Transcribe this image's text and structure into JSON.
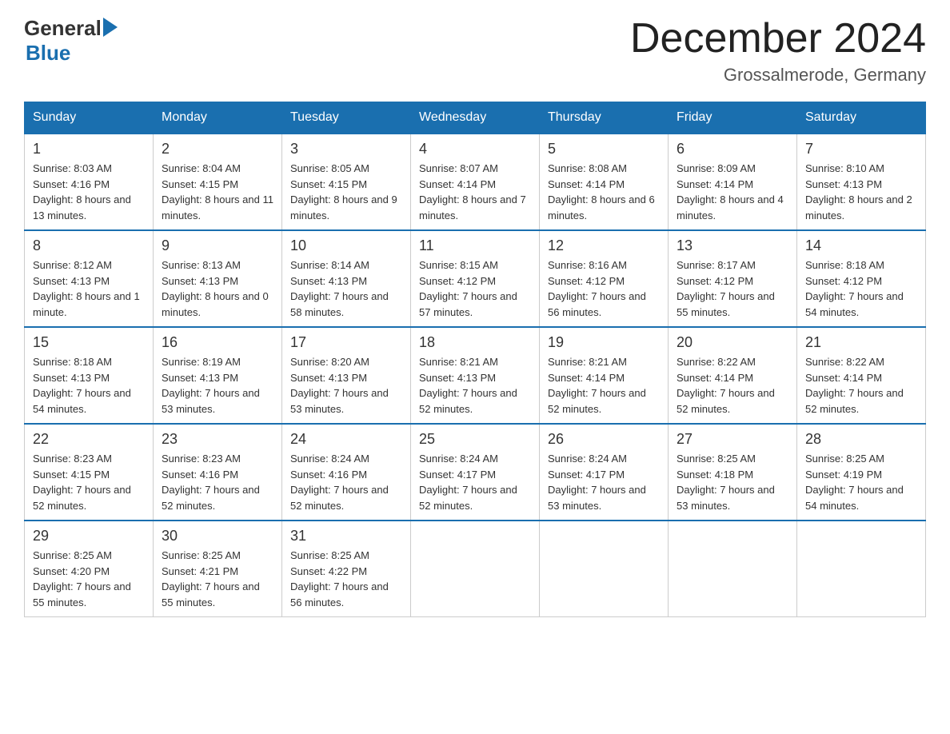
{
  "header": {
    "logo_text_general": "General",
    "logo_text_blue": "Blue",
    "month_title": "December 2024",
    "location": "Grossalmerode, Germany"
  },
  "days_of_week": [
    "Sunday",
    "Monday",
    "Tuesday",
    "Wednesday",
    "Thursday",
    "Friday",
    "Saturday"
  ],
  "weeks": [
    [
      {
        "day": "1",
        "sunrise": "8:03 AM",
        "sunset": "4:16 PM",
        "daylight": "8 hours and 13 minutes."
      },
      {
        "day": "2",
        "sunrise": "8:04 AM",
        "sunset": "4:15 PM",
        "daylight": "8 hours and 11 minutes."
      },
      {
        "day": "3",
        "sunrise": "8:05 AM",
        "sunset": "4:15 PM",
        "daylight": "8 hours and 9 minutes."
      },
      {
        "day": "4",
        "sunrise": "8:07 AM",
        "sunset": "4:14 PM",
        "daylight": "8 hours and 7 minutes."
      },
      {
        "day": "5",
        "sunrise": "8:08 AM",
        "sunset": "4:14 PM",
        "daylight": "8 hours and 6 minutes."
      },
      {
        "day": "6",
        "sunrise": "8:09 AM",
        "sunset": "4:14 PM",
        "daylight": "8 hours and 4 minutes."
      },
      {
        "day": "7",
        "sunrise": "8:10 AM",
        "sunset": "4:13 PM",
        "daylight": "8 hours and 2 minutes."
      }
    ],
    [
      {
        "day": "8",
        "sunrise": "8:12 AM",
        "sunset": "4:13 PM",
        "daylight": "8 hours and 1 minute."
      },
      {
        "day": "9",
        "sunrise": "8:13 AM",
        "sunset": "4:13 PM",
        "daylight": "8 hours and 0 minutes."
      },
      {
        "day": "10",
        "sunrise": "8:14 AM",
        "sunset": "4:13 PM",
        "daylight": "7 hours and 58 minutes."
      },
      {
        "day": "11",
        "sunrise": "8:15 AM",
        "sunset": "4:12 PM",
        "daylight": "7 hours and 57 minutes."
      },
      {
        "day": "12",
        "sunrise": "8:16 AM",
        "sunset": "4:12 PM",
        "daylight": "7 hours and 56 minutes."
      },
      {
        "day": "13",
        "sunrise": "8:17 AM",
        "sunset": "4:12 PM",
        "daylight": "7 hours and 55 minutes."
      },
      {
        "day": "14",
        "sunrise": "8:18 AM",
        "sunset": "4:12 PM",
        "daylight": "7 hours and 54 minutes."
      }
    ],
    [
      {
        "day": "15",
        "sunrise": "8:18 AM",
        "sunset": "4:13 PM",
        "daylight": "7 hours and 54 minutes."
      },
      {
        "day": "16",
        "sunrise": "8:19 AM",
        "sunset": "4:13 PM",
        "daylight": "7 hours and 53 minutes."
      },
      {
        "day": "17",
        "sunrise": "8:20 AM",
        "sunset": "4:13 PM",
        "daylight": "7 hours and 53 minutes."
      },
      {
        "day": "18",
        "sunrise": "8:21 AM",
        "sunset": "4:13 PM",
        "daylight": "7 hours and 52 minutes."
      },
      {
        "day": "19",
        "sunrise": "8:21 AM",
        "sunset": "4:14 PM",
        "daylight": "7 hours and 52 minutes."
      },
      {
        "day": "20",
        "sunrise": "8:22 AM",
        "sunset": "4:14 PM",
        "daylight": "7 hours and 52 minutes."
      },
      {
        "day": "21",
        "sunrise": "8:22 AM",
        "sunset": "4:14 PM",
        "daylight": "7 hours and 52 minutes."
      }
    ],
    [
      {
        "day": "22",
        "sunrise": "8:23 AM",
        "sunset": "4:15 PM",
        "daylight": "7 hours and 52 minutes."
      },
      {
        "day": "23",
        "sunrise": "8:23 AM",
        "sunset": "4:16 PM",
        "daylight": "7 hours and 52 minutes."
      },
      {
        "day": "24",
        "sunrise": "8:24 AM",
        "sunset": "4:16 PM",
        "daylight": "7 hours and 52 minutes."
      },
      {
        "day": "25",
        "sunrise": "8:24 AM",
        "sunset": "4:17 PM",
        "daylight": "7 hours and 52 minutes."
      },
      {
        "day": "26",
        "sunrise": "8:24 AM",
        "sunset": "4:17 PM",
        "daylight": "7 hours and 53 minutes."
      },
      {
        "day": "27",
        "sunrise": "8:25 AM",
        "sunset": "4:18 PM",
        "daylight": "7 hours and 53 minutes."
      },
      {
        "day": "28",
        "sunrise": "8:25 AM",
        "sunset": "4:19 PM",
        "daylight": "7 hours and 54 minutes."
      }
    ],
    [
      {
        "day": "29",
        "sunrise": "8:25 AM",
        "sunset": "4:20 PM",
        "daylight": "7 hours and 55 minutes."
      },
      {
        "day": "30",
        "sunrise": "8:25 AM",
        "sunset": "4:21 PM",
        "daylight": "7 hours and 55 minutes."
      },
      {
        "day": "31",
        "sunrise": "8:25 AM",
        "sunset": "4:22 PM",
        "daylight": "7 hours and 56 minutes."
      },
      null,
      null,
      null,
      null
    ]
  ],
  "labels": {
    "sunrise_prefix": "Sunrise: ",
    "sunset_prefix": "Sunset: ",
    "daylight_prefix": "Daylight: "
  }
}
